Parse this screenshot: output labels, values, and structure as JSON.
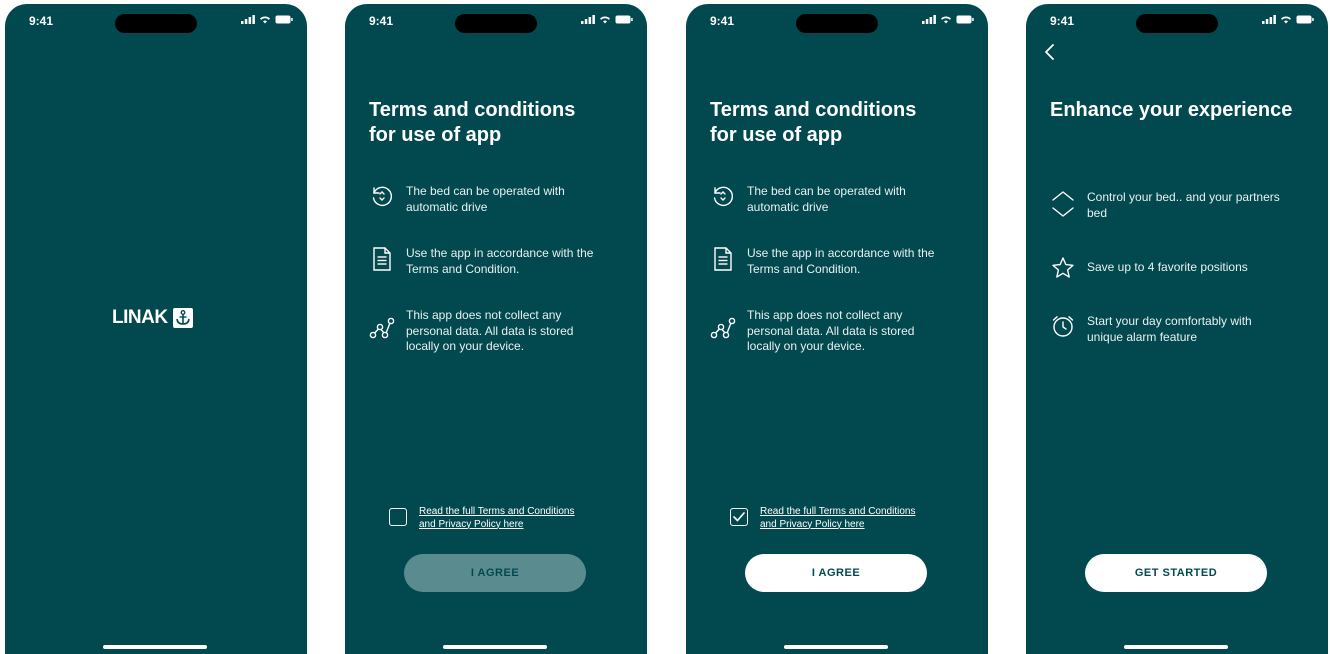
{
  "status_bar": {
    "time": "9:41"
  },
  "splash": {
    "logo_text": "LINAK"
  },
  "terms": {
    "title": "Terms and conditions\nfor use of app",
    "features": [
      {
        "icon": "rotate-icon",
        "text": "The bed can be operated with\nautomatic drive"
      },
      {
        "icon": "document-icon",
        "text": "Use the app in accordance with the\nTerms and Condition."
      },
      {
        "icon": "data-nodes-icon",
        "text": "This app does not collect any\npersonal data. All data is stored\nlocally on your device."
      }
    ],
    "consent_link": "Read the full Terms and Conditions\nand Privacy Policy here",
    "agree_label": "I AGREE",
    "checked_state_screen2": false,
    "checked_state_screen3": true
  },
  "enhance": {
    "title": "Enhance your experience",
    "features": [
      {
        "icon": "up-down-chevron-icon",
        "text": "Control your bed.. and your partners\nbed"
      },
      {
        "icon": "star-icon",
        "text": "Save up to 4 favorite positions"
      },
      {
        "icon": "alarm-clock-icon",
        "text": "Start your day comfortably with\nunique alarm feature"
      }
    ],
    "cta_label": "GET STARTED"
  },
  "colors": {
    "background": "#02494f",
    "button_disabled": "#5a8c8f",
    "button_enabled": "#ffffff"
  }
}
